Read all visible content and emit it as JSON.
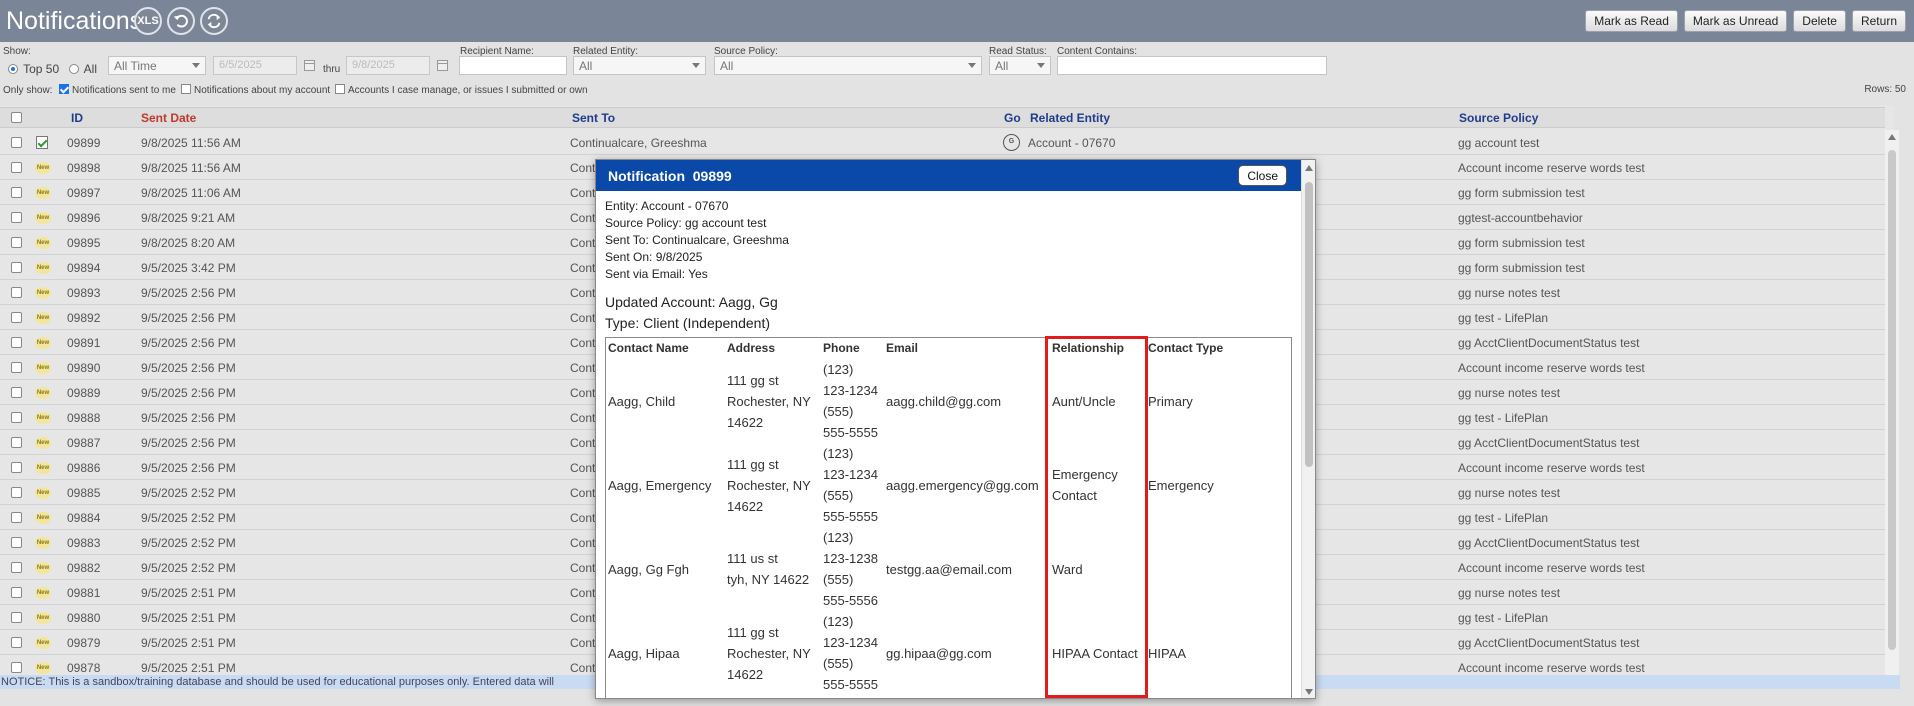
{
  "title": "Notifications",
  "header_icons": [
    "xls-export-icon",
    "undo-icon",
    "refresh-icon"
  ],
  "header_xls_text": "XLS",
  "toolbar": {
    "mark_read": "Mark as Read",
    "mark_unread": "Mark as Unread",
    "delete": "Delete",
    "return": "Return"
  },
  "filters": {
    "show_label": "Show:",
    "top50_label": "Top 50",
    "all_label": "All",
    "time_range": "All Time",
    "date_from": "6/5/2025",
    "thru_label": "thru",
    "date_to": "9/8/2025",
    "recipient_label": "Recipient Name:",
    "related_label": "Related Entity:",
    "related_value": "All",
    "source_label": "Source Policy:",
    "source_value": "All",
    "read_label": "Read Status:",
    "read_value": "All",
    "content_label": "Content Contains:",
    "only_show_label": "Only show:",
    "opt_sent_to_me": "Notifications sent to me",
    "opt_about_account": "Notifications about my account",
    "opt_accounts": "Accounts I case manage, or issues I submitted or own",
    "rows_count": "Rows: 50"
  },
  "columns": {
    "id": "ID",
    "sent_date": "Sent Date",
    "sent_to": "Sent To",
    "go": "Go",
    "related": "Related Entity",
    "source": "Source Policy"
  },
  "new_badge": "New",
  "go_icon_text": "G",
  "rows": [
    {
      "id": "09899",
      "date": "9/8/2025 11:56 AM",
      "to": "Continualcare, Greeshma",
      "related": "Account - 07670",
      "source": "gg account test",
      "read": true
    },
    {
      "id": "09898",
      "date": "9/8/2025 11:56 AM",
      "to": "Cont",
      "related": "",
      "source": "Account income reserve words test",
      "read": false
    },
    {
      "id": "09897",
      "date": "9/8/2025 11:06 AM",
      "to": "Cont",
      "related": "",
      "source": "gg form submission test",
      "read": false
    },
    {
      "id": "09896",
      "date": "9/8/2025 9:21 AM",
      "to": "Cont",
      "related": "",
      "source": "ggtest-accountbehavior",
      "read": false
    },
    {
      "id": "09895",
      "date": "9/8/2025 8:20 AM",
      "to": "Cont",
      "related": "",
      "source": "gg form submission test",
      "read": false
    },
    {
      "id": "09894",
      "date": "9/5/2025 3:42 PM",
      "to": "Cont",
      "related": "",
      "source": "gg form submission test",
      "read": false
    },
    {
      "id": "09893",
      "date": "9/5/2025 2:56 PM",
      "to": "Cont",
      "related": "",
      "source": "gg nurse notes test",
      "read": false
    },
    {
      "id": "09892",
      "date": "9/5/2025 2:56 PM",
      "to": "Cont",
      "related": "",
      "source": "gg test - LifePlan",
      "read": false
    },
    {
      "id": "09891",
      "date": "9/5/2025 2:56 PM",
      "to": "Cont",
      "related": "",
      "source": "gg AcctClientDocumentStatus test",
      "read": false
    },
    {
      "id": "09890",
      "date": "9/5/2025 2:56 PM",
      "to": "Cont",
      "related": "",
      "source": "Account income reserve words test",
      "read": false
    },
    {
      "id": "09889",
      "date": "9/5/2025 2:56 PM",
      "to": "Cont",
      "related": "",
      "source": "gg nurse notes test",
      "read": false
    },
    {
      "id": "09888",
      "date": "9/5/2025 2:56 PM",
      "to": "Cont",
      "related": "",
      "source": "gg test - LifePlan",
      "read": false
    },
    {
      "id": "09887",
      "date": "9/5/2025 2:56 PM",
      "to": "Cont",
      "related": "",
      "source": "gg AcctClientDocumentStatus test",
      "read": false
    },
    {
      "id": "09886",
      "date": "9/5/2025 2:56 PM",
      "to": "Cont",
      "related": "",
      "source": "Account income reserve words test",
      "read": false
    },
    {
      "id": "09885",
      "date": "9/5/2025 2:52 PM",
      "to": "Cont",
      "related": "",
      "source": "gg nurse notes test",
      "read": false
    },
    {
      "id": "09884",
      "date": "9/5/2025 2:52 PM",
      "to": "Cont",
      "related": "",
      "source": "gg test - LifePlan",
      "read": false
    },
    {
      "id": "09883",
      "date": "9/5/2025 2:52 PM",
      "to": "Cont",
      "related": "",
      "source": "gg AcctClientDocumentStatus test",
      "read": false
    },
    {
      "id": "09882",
      "date": "9/5/2025 2:52 PM",
      "to": "Cont",
      "related": "",
      "source": "Account income reserve words test",
      "read": false
    },
    {
      "id": "09881",
      "date": "9/5/2025 2:51 PM",
      "to": "Cont",
      "related": "",
      "source": "gg nurse notes test",
      "read": false
    },
    {
      "id": "09880",
      "date": "9/5/2025 2:51 PM",
      "to": "Cont",
      "related": "",
      "source": "gg test - LifePlan",
      "read": false
    },
    {
      "id": "09879",
      "date": "9/5/2025 2:51 PM",
      "to": "Cont",
      "related": "",
      "source": "gg AcctClientDocumentStatus test",
      "read": false
    },
    {
      "id": "09878",
      "date": "9/5/2025 2:51 PM",
      "to": "Cont",
      "related": "",
      "source": "Account income reserve words test",
      "read": false
    }
  ],
  "notice": "NOTICE: This is a sandbox/training database and should be used for educational purposes only. Entered data will",
  "modal": {
    "title": "Notification  09899",
    "close": "Close",
    "entity": "Entity: Account - 07670",
    "source": "Source Policy: gg account test",
    "sent_to": "Sent To: Continualcare, Greeshma",
    "sent_on": "Sent On: 9/8/2025",
    "via_email": "Sent via Email: Yes",
    "updated": "Updated Account: Aagg, Gg",
    "type": "Type: Client (Independent)",
    "table_headers": {
      "name": "Contact Name",
      "address": "Address",
      "phone": "Phone",
      "email": "Email",
      "relationship": "Relationship",
      "contact_type": "Contact Type"
    },
    "contacts": [
      {
        "name": "Aagg, Child",
        "address": [
          "111 gg st",
          "Rochester, NY",
          "14622"
        ],
        "phone": [
          "(123)",
          "123-1234",
          "(555)",
          "555-5555"
        ],
        "email": "aagg.child@gg.com",
        "relationship": [
          "Aunt/Uncle"
        ],
        "type": "Primary"
      },
      {
        "name": "Aagg, Emergency",
        "address": [
          "111 gg st",
          "Rochester, NY",
          "14622"
        ],
        "phone": [
          "(123)",
          "123-1234",
          "(555)",
          "555-5555"
        ],
        "email": "aagg.emergency@gg.com",
        "relationship": [
          "Emergency",
          "Contact"
        ],
        "type": "Emergency"
      },
      {
        "name": "Aagg, Gg Fgh",
        "address": [
          "111 us st",
          "tyh, NY 14622"
        ],
        "phone": [
          "(123)",
          "123-1238",
          "(555)",
          "555-5556"
        ],
        "email": "testgg.aa@email.com",
        "relationship": [
          "Ward"
        ],
        "type": ""
      },
      {
        "name": "Aagg, Hipaa",
        "address": [
          "111 gg st",
          "Rochester, NY",
          "14622"
        ],
        "phone": [
          "(123)",
          "123-1234",
          "(555)",
          "555-5555"
        ],
        "email": "gg.hipaa@gg.com",
        "relationship": [
          "HIPAA Contact"
        ],
        "type": "HIPAA"
      }
    ]
  },
  "colors": {
    "header_bg": "#7a8598",
    "modal_title_bg": "#0b49a8",
    "highlight": "#e21b1b",
    "notice_bg": "#c9dbf2"
  }
}
